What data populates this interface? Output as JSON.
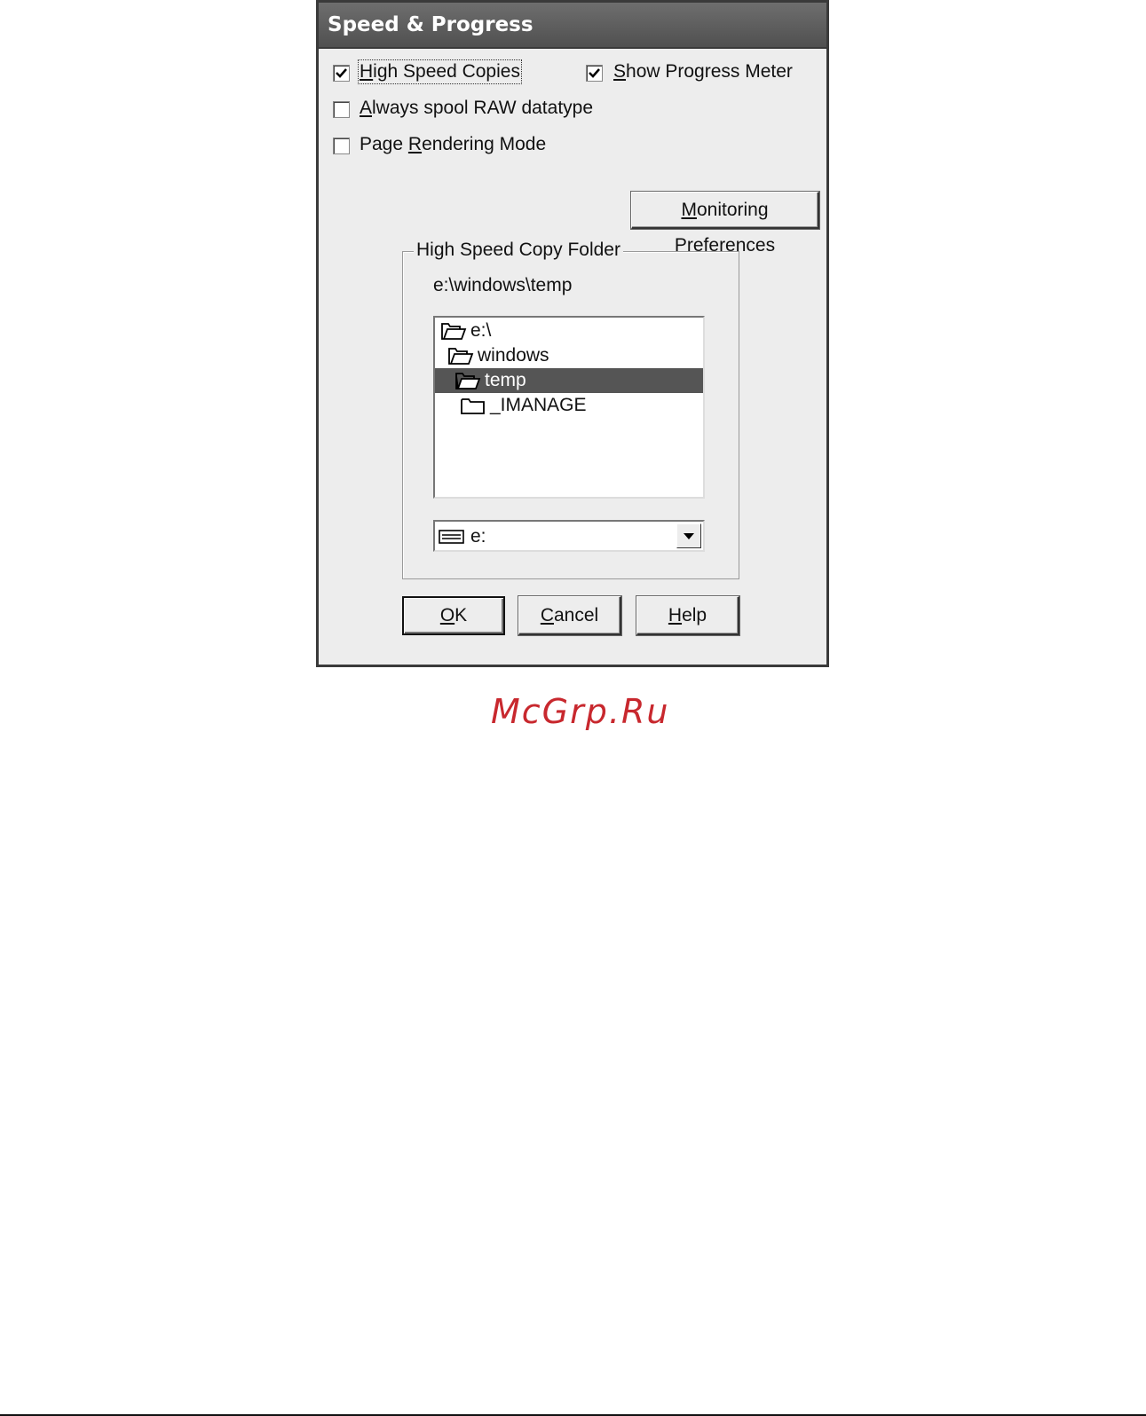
{
  "dialog": {
    "title": "Speed & Progress"
  },
  "options": {
    "high_speed_copies": {
      "before": "",
      "key": "H",
      "after": "igh Speed Copies",
      "checked": true
    },
    "show_progress_meter": {
      "before": "",
      "key": "S",
      "after": "how Progress Meter",
      "checked": true
    },
    "always_spool_raw": {
      "before": "",
      "key": "A",
      "after": "lways spool RAW datatype",
      "checked": false
    },
    "page_rendering_mode": {
      "before": "Page ",
      "key": "R",
      "after": "endering Mode",
      "checked": false
    }
  },
  "monitoring_button": {
    "before": "",
    "key": "M",
    "after": "onitoring Preferences"
  },
  "copy_folder": {
    "legend": "High Speed Copy Folder",
    "current_path": "e:\\windows\\temp",
    "tree": [
      {
        "label": "e:\\",
        "icon": "open-folder-icon",
        "level": 0,
        "selected": false
      },
      {
        "label": "windows",
        "icon": "open-folder-icon",
        "level": 1,
        "selected": false
      },
      {
        "label": "temp",
        "icon": "open-folder-icon",
        "level": 2,
        "selected": true
      },
      {
        "label": "_IMANAGE",
        "icon": "closed-folder-icon",
        "level": 3,
        "selected": false
      }
    ],
    "drive": {
      "value": "e:",
      "icon": "drive-icon"
    }
  },
  "buttons": {
    "ok": {
      "before": "",
      "key": "O",
      "after": "K"
    },
    "cancel": {
      "before": "",
      "key": "C",
      "after": "ancel"
    },
    "help": {
      "before": "",
      "key": "H",
      "after": "elp"
    }
  },
  "watermark": "McGrp.Ru",
  "colors": {
    "title_bar": "#5a5a5a",
    "selection": "#555555",
    "watermark": "#c8282e"
  }
}
